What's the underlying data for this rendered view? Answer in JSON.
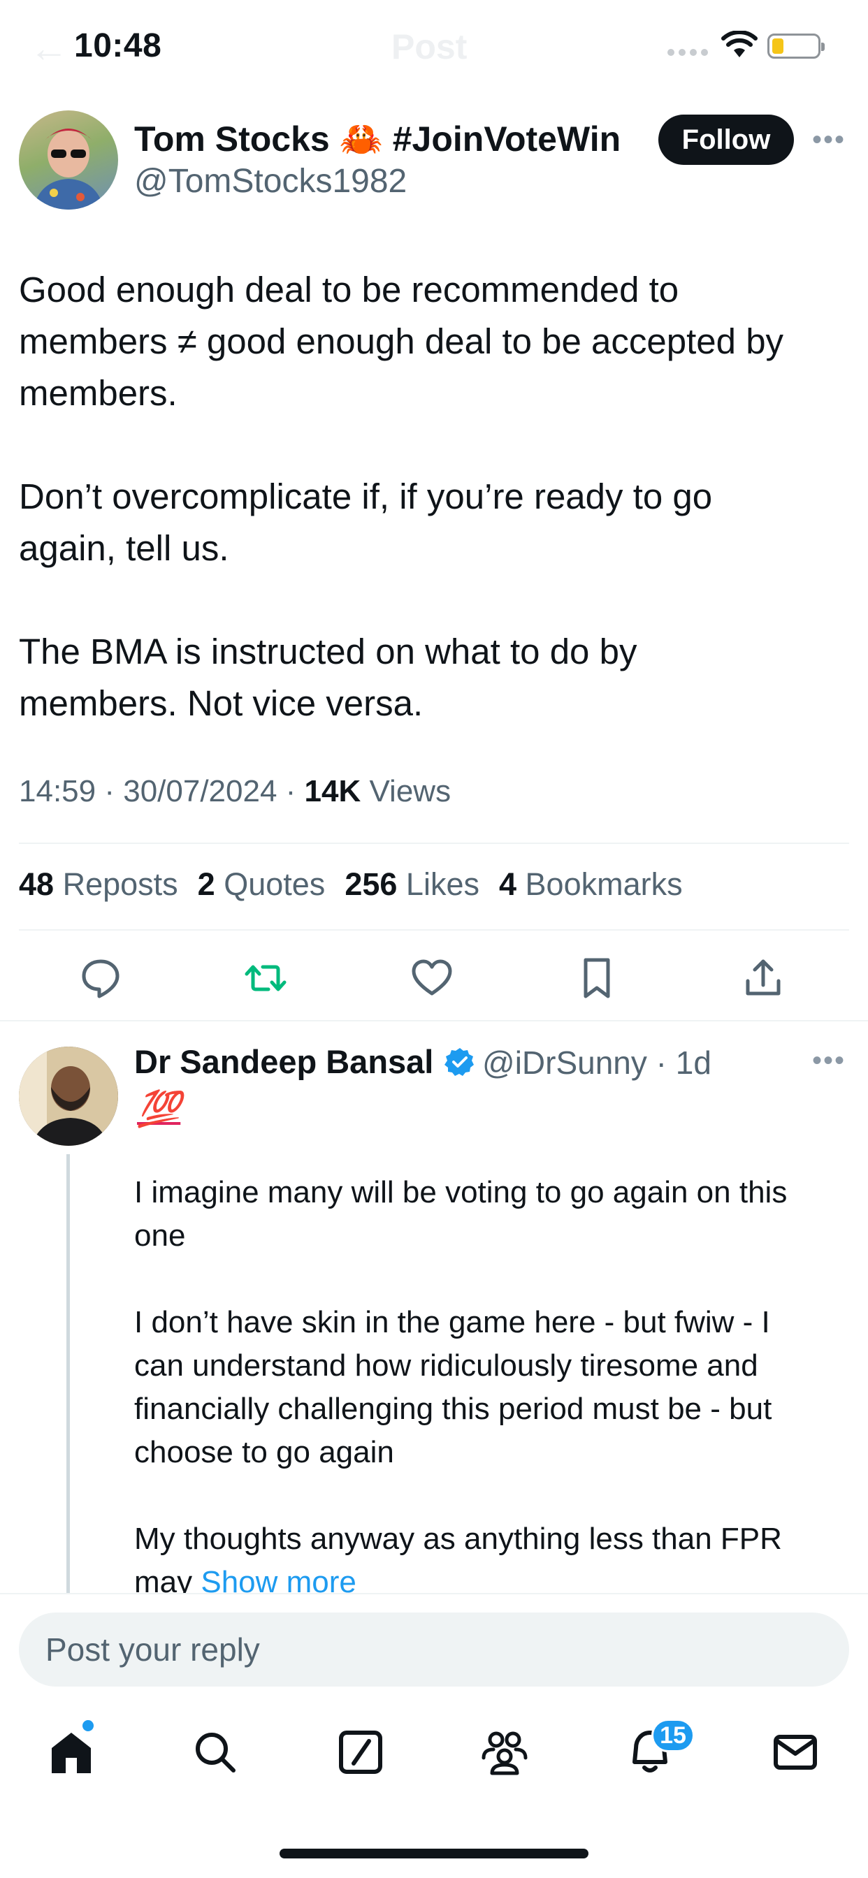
{
  "status_bar": {
    "time": "10:48"
  },
  "header": {
    "title": "Post"
  },
  "tweet": {
    "author_name": "Tom Stocks 🦀 #JoinVoteWin",
    "author_handle": "@TomStocks1982",
    "follow_label": "Follow",
    "text": "Good enough deal to be recommended to\nmembers ≠ good enough deal to be accepted by\nmembers.\n\nDon’t overcomplicate if, if you’re ready to go\nagain, tell us.\n\nThe BMA is instructed on what to do by\nmembers. Not vice versa.",
    "time": "14:59",
    "date": "30/07/2024",
    "views_count": "14K",
    "views_label": "Views",
    "stats": {
      "reposts_count": "48",
      "reposts_label": "Reposts",
      "quotes_count": "2",
      "quotes_label": "Quotes",
      "likes_count": "256",
      "likes_label": "Likes",
      "bookmarks_count": "4",
      "bookmarks_label": "Bookmarks"
    }
  },
  "reply": {
    "author_name": "Dr Sandeep Bansal",
    "author_handle": "@iDrSunny",
    "age": "1d",
    "emoji": "💯",
    "text": "I imagine many will be voting to go again on this\none\n\nI don’t have skin in the game here - but fwiw - I\ncan understand how ridiculously tiresome and\nfinancially challenging this period must be - but\nchoose to go again\n\nMy thoughts anyway as anything less than FPR\nmay",
    "show_more": "Show more"
  },
  "composer": {
    "placeholder": "Post your reply"
  },
  "tab_bar": {
    "notifications_badge": "15"
  },
  "colors": {
    "accent": "#1d9bf0",
    "repost_green": "#00ba7c",
    "text": "#0f1419",
    "muted": "#536471"
  },
  "icons": [
    "back-arrow-icon",
    "more-icon",
    "reply-icon",
    "repost-icon",
    "like-icon",
    "bookmark-icon",
    "share-icon",
    "verified-icon",
    "home-icon",
    "search-icon",
    "grok-icon",
    "communities-icon",
    "notifications-icon",
    "messages-icon"
  ]
}
